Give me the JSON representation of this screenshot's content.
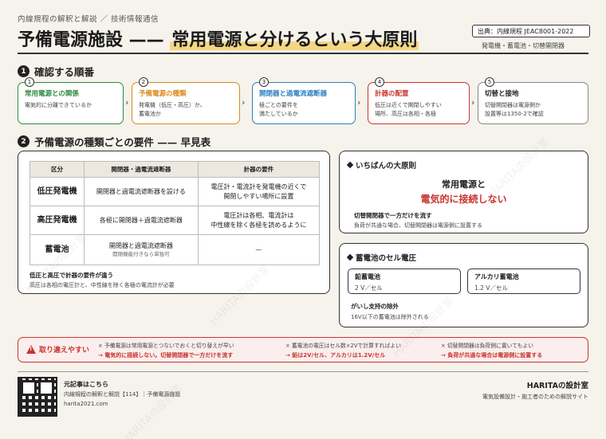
{
  "header": {
    "breadcrumb": "内線規程の解釈と解説 ／ 技術情報通信",
    "title_left": "予備電源施設 —— ",
    "title_highlight": "常用電源と分けるという大原則",
    "source": "出典：内線規程 JEAC8001-2022",
    "subtags": "発電機・蓄電池・切替開閉器"
  },
  "section1": {
    "number": "1",
    "title": "確認する順番",
    "steps": [
      {
        "num": "1",
        "title": "常用電源との関係",
        "desc": "電気的に分離できているか",
        "color": "#2e8b3d"
      },
      {
        "num": "2",
        "title": "予備電源の種類",
        "desc": "発電機（低圧・高圧）か、\n蓄電池か",
        "color": "#d98a1f"
      },
      {
        "num": "3",
        "title": "開閉器と過電流遮断器",
        "desc": "極ごとの要件を\n満たしているか",
        "color": "#2a7fc1"
      },
      {
        "num": "4",
        "title": "計器の配置",
        "desc": "低圧は近くで開閉しやすい\n場所、高圧は各相・各極",
        "color": "#c8352e"
      },
      {
        "num": "5",
        "title": "切替と接地",
        "desc": "切替開閉器は電源側か\n設置等は1350-2で確認",
        "color": "#888888"
      }
    ]
  },
  "section2": {
    "number": "2",
    "title": "予備電源の種類ごとの要件 —— 早見表",
    "table": {
      "headers": [
        "区分",
        "開閉器・過電流遮断器",
        "計器の要件"
      ],
      "rows": [
        {
          "cat": "低圧発電機",
          "switch": "開閉器と過電流遮断器を設ける",
          "switch_note": "",
          "meter": "電圧計・電流計を発電機の近くで\n開閉しやすい場所に設置"
        },
        {
          "cat": "高圧発電機",
          "switch": "各極に開閉器＋過電流遮断器",
          "switch_note": "",
          "meter": "電圧計は各相、電流計は\n中性線を除く各極を読めるように"
        },
        {
          "cat": "蓄電池",
          "switch": "開閉器と過電流遮断器",
          "switch_note": "開閉機能付きなら単独可",
          "meter": "—"
        }
      ]
    },
    "note_title": "低圧と高圧で計器の要件が違う",
    "note_body": "高圧は各相の電圧計と、中性線を除く各極の電流計が必要"
  },
  "principle": {
    "title": "いちばんの大原則",
    "line1": "常用電源と",
    "line2": "電気的に接続しない",
    "sub_title": "切替開閉器で一方だけを流す",
    "sub_body": "負荷が共通な場合、切替開閉器は電源側に設置する"
  },
  "battery": {
    "title": "蓄電池のセル電圧",
    "items": [
      {
        "name": "鉛蓄電池",
        "value": "2 V／セル"
      },
      {
        "name": "アルカリ蓄電池",
        "value": "1.2 V／セル"
      }
    ],
    "sub_title": "がいし支持の除外",
    "sub_body": "16V以下の蓄電池は除外される"
  },
  "pitfalls": {
    "label": "取り違えやすい",
    "items": [
      {
        "mistake": "× 予備電源は常用電源とつないでおくと切り替えが早い",
        "fix": "→ 電気的に接続しない。切替開閉器で一方だけを流す"
      },
      {
        "mistake": "× 蓄電池の電圧はセル数×2Vで計算すればよい",
        "fix": "→ 鉛は2V/セル、アルカリは1.2V/セル"
      },
      {
        "mistake": "× 切替開閉器は負荷側に置いてもよい",
        "fix": "→ 負荷が共通な場合は電源側に設置する"
      }
    ]
  },
  "footer": {
    "label": "元記事はこちら",
    "line1": "内線規程の解釈と解説【114】｜予備電源施設",
    "line2": "harita2021.com",
    "brand": "HARITAの設計室",
    "brand_sub": "電気設備設計・施工者のための解説サイト"
  },
  "watermark": "HARITAの設計室"
}
